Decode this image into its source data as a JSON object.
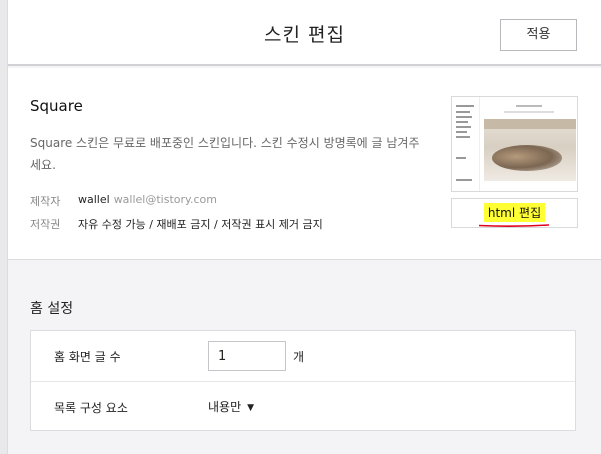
{
  "header": {
    "title": "스킨 편집",
    "apply_label": "적용"
  },
  "skin": {
    "name": "Square",
    "description": "Square 스킨은 무료로 배포중인 스킨입니다. 스킨 수정시 방명록에 글 남겨주세요.",
    "creator_label": "제작자",
    "creator_name": "wallel",
    "creator_email": "wallel@tistory.com",
    "copyright_label": "저작권",
    "copyright_value": "자유 수정 가능 / 재배포 금지 / 저작권 표시 제거 금지",
    "html_edit_label": "html 편집",
    "highlight_color": "#ffff33",
    "underline_color": "#e0001a"
  },
  "home_settings": {
    "title": "홈 설정",
    "post_count_label": "홈 화면 글 수",
    "post_count_value": "1",
    "post_count_unit": "개",
    "list_composition_label": "목록 구성 요소",
    "list_composition_value": "내용만"
  }
}
